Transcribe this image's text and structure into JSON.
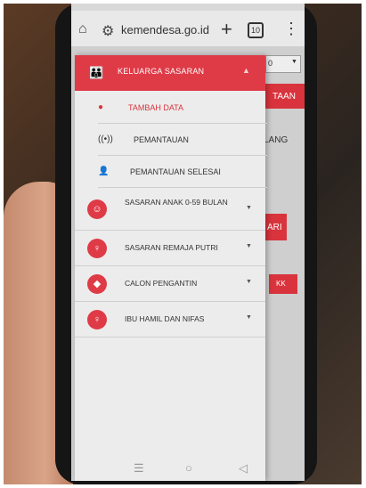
{
  "browser": {
    "url": "kemendesa.go.id",
    "tab_count": "10"
  },
  "background_page": {
    "partial_labels": [
      "0",
      "TAAN",
      "LANG",
      "ARI",
      "KK"
    ]
  },
  "drawer": {
    "header": "KELUARGA SASARAN",
    "sub_items": [
      {
        "label": "TAMBAH DATA",
        "icon": "add-user-icon"
      },
      {
        "label": "PEMANTAUAN",
        "icon": "broadcast-icon"
      },
      {
        "label": "PEMANTAUAN SELESAI",
        "icon": "user-check-icon"
      }
    ],
    "groups": [
      {
        "label": "SASARAN ANAK 0-59 BULAN",
        "icon": "child-icon"
      },
      {
        "label": "SASARAN REMAJA PUTRI",
        "icon": "female-icon"
      },
      {
        "label": "CALON PENGANTIN",
        "icon": "diamond-icon"
      },
      {
        "label": "IBU HAMIL DAN NIFAS",
        "icon": "pregnant-icon"
      }
    ]
  },
  "colors": {
    "accent": "#df3b47",
    "active_text": "#d9343d"
  }
}
